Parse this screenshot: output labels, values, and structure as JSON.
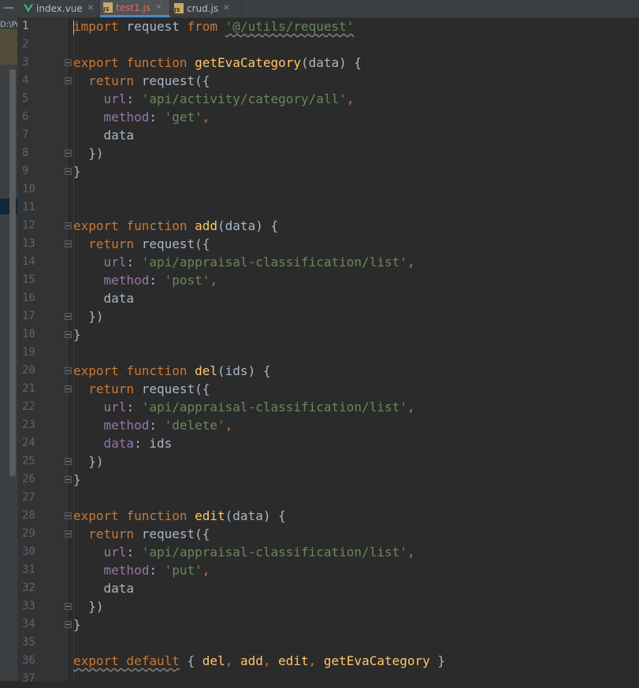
{
  "tabs": [
    {
      "label": "index.vue",
      "icon": "vue-icon",
      "active": false
    },
    {
      "label": "test1.js",
      "icon": "js-file-icon",
      "active": true
    },
    {
      "label": "crud.js",
      "icon": "js-file-icon",
      "active": false
    }
  ],
  "sidebar": {
    "breadcrumb": "D:\\Pr"
  },
  "colors": {
    "keyword": "#cc7832",
    "function": "#ffc66d",
    "string": "#6a8759",
    "property": "#9876aa",
    "plain": "#a9b7c6",
    "linenumber": "#606366"
  },
  "editor": {
    "line_numbers": [
      "1",
      "2",
      "3",
      "4",
      "5",
      "6",
      "7",
      "8",
      "9",
      "10",
      "11",
      "12",
      "13",
      "14",
      "15",
      "16",
      "17",
      "18",
      "19",
      "20",
      "21",
      "22",
      "23",
      "24",
      "25",
      "26",
      "27",
      "28",
      "29",
      "30",
      "31",
      "32",
      "33",
      "34",
      "35",
      "36",
      "37"
    ],
    "lines": [
      [
        {
          "t": "kw",
          "v": "import"
        },
        {
          "t": "plain",
          "v": " request "
        },
        {
          "t": "kw",
          "v": "from"
        },
        {
          "t": "plain",
          "v": " "
        },
        {
          "t": "str",
          "v": "'@/utils/request'"
        }
      ],
      [],
      [
        {
          "t": "kw",
          "v": "export function "
        },
        {
          "t": "fn",
          "v": "getEvaCategory"
        },
        {
          "t": "plain",
          "v": "(data) {"
        }
      ],
      [
        {
          "t": "plain",
          "v": "  "
        },
        {
          "t": "kw",
          "v": "return"
        },
        {
          "t": "plain",
          "v": " request({"
        }
      ],
      [
        {
          "t": "plain",
          "v": "    "
        },
        {
          "t": "prop",
          "v": "url"
        },
        {
          "t": "plain",
          "v": ": "
        },
        {
          "t": "str",
          "v": "'api/activity/category/all'"
        },
        {
          "t": "kw",
          "v": ","
        }
      ],
      [
        {
          "t": "plain",
          "v": "    "
        },
        {
          "t": "prop",
          "v": "method"
        },
        {
          "t": "plain",
          "v": ": "
        },
        {
          "t": "str",
          "v": "'get'"
        },
        {
          "t": "kw",
          "v": ","
        }
      ],
      [
        {
          "t": "plain",
          "v": "    data"
        }
      ],
      [
        {
          "t": "plain",
          "v": "  })"
        }
      ],
      [
        {
          "t": "plain",
          "v": "}"
        }
      ],
      [],
      [],
      [
        {
          "t": "kw",
          "v": "export function "
        },
        {
          "t": "fn",
          "v": "add"
        },
        {
          "t": "plain",
          "v": "(data) {"
        }
      ],
      [
        {
          "t": "plain",
          "v": "  "
        },
        {
          "t": "kw",
          "v": "return"
        },
        {
          "t": "plain",
          "v": " request({"
        }
      ],
      [
        {
          "t": "plain",
          "v": "    "
        },
        {
          "t": "prop",
          "v": "url"
        },
        {
          "t": "plain",
          "v": ": "
        },
        {
          "t": "str",
          "v": "'api/appraisal-classification/list'"
        },
        {
          "t": "kw",
          "v": ","
        }
      ],
      [
        {
          "t": "plain",
          "v": "    "
        },
        {
          "t": "prop",
          "v": "method"
        },
        {
          "t": "plain",
          "v": ": "
        },
        {
          "t": "str",
          "v": "'post'"
        },
        {
          "t": "kw",
          "v": ","
        }
      ],
      [
        {
          "t": "plain",
          "v": "    data"
        }
      ],
      [
        {
          "t": "plain",
          "v": "  })"
        }
      ],
      [
        {
          "t": "plain",
          "v": "}"
        }
      ],
      [],
      [
        {
          "t": "kw",
          "v": "export function "
        },
        {
          "t": "fn",
          "v": "del"
        },
        {
          "t": "plain",
          "v": "(ids) {"
        }
      ],
      [
        {
          "t": "plain",
          "v": "  "
        },
        {
          "t": "kw",
          "v": "return"
        },
        {
          "t": "plain",
          "v": " request({"
        }
      ],
      [
        {
          "t": "plain",
          "v": "    "
        },
        {
          "t": "prop",
          "v": "url"
        },
        {
          "t": "plain",
          "v": ": "
        },
        {
          "t": "str",
          "v": "'api/appraisal-classification/list'"
        },
        {
          "t": "kw",
          "v": ","
        }
      ],
      [
        {
          "t": "plain",
          "v": "    "
        },
        {
          "t": "prop",
          "v": "method"
        },
        {
          "t": "plain",
          "v": ": "
        },
        {
          "t": "str",
          "v": "'delete'"
        },
        {
          "t": "kw",
          "v": ","
        }
      ],
      [
        {
          "t": "plain",
          "v": "    "
        },
        {
          "t": "prop",
          "v": "data"
        },
        {
          "t": "plain",
          "v": ": ids"
        }
      ],
      [
        {
          "t": "plain",
          "v": "  })"
        }
      ],
      [
        {
          "t": "plain",
          "v": "}"
        }
      ],
      [],
      [
        {
          "t": "kw",
          "v": "export function "
        },
        {
          "t": "fn",
          "v": "edit"
        },
        {
          "t": "plain",
          "v": "(data) {"
        }
      ],
      [
        {
          "t": "plain",
          "v": "  "
        },
        {
          "t": "kw",
          "v": "return"
        },
        {
          "t": "plain",
          "v": " request({"
        }
      ],
      [
        {
          "t": "plain",
          "v": "    "
        },
        {
          "t": "prop",
          "v": "url"
        },
        {
          "t": "plain",
          "v": ": "
        },
        {
          "t": "str",
          "v": "'api/appraisal-classification/list'"
        },
        {
          "t": "kw",
          "v": ","
        }
      ],
      [
        {
          "t": "plain",
          "v": "    "
        },
        {
          "t": "prop",
          "v": "method"
        },
        {
          "t": "plain",
          "v": ": "
        },
        {
          "t": "str",
          "v": "'put'"
        },
        {
          "t": "kw",
          "v": ","
        }
      ],
      [
        {
          "t": "plain",
          "v": "    data"
        }
      ],
      [
        {
          "t": "plain",
          "v": "  })"
        }
      ],
      [
        {
          "t": "plain",
          "v": "}"
        }
      ],
      [],
      [
        {
          "t": "kw",
          "v": "export default"
        },
        {
          "t": "plain",
          "v": " { "
        },
        {
          "t": "fn",
          "v": "del"
        },
        {
          "t": "kw",
          "v": ", "
        },
        {
          "t": "fn",
          "v": "add"
        },
        {
          "t": "kw",
          "v": ", "
        },
        {
          "t": "fn",
          "v": "edit"
        },
        {
          "t": "kw",
          "v": ", "
        },
        {
          "t": "fn",
          "v": "getEvaCategory"
        },
        {
          "t": "plain",
          "v": " }"
        }
      ],
      []
    ]
  }
}
